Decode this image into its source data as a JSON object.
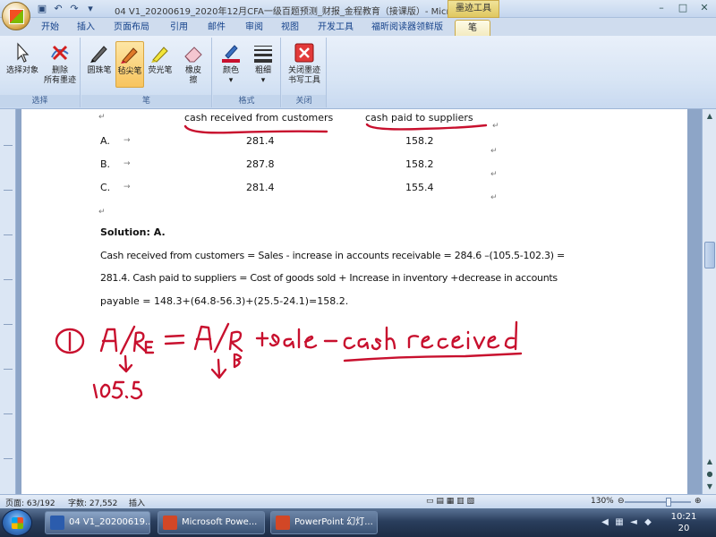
{
  "titlebar": {
    "title": "04 V1_20200619_2020年12月CFA一级百题预测_财报_金程教育（接课版）- Micros...",
    "context_tab": "墨迹工具"
  },
  "tabs": [
    "开始",
    "插入",
    "页面布局",
    "引用",
    "邮件",
    "审阅",
    "视图",
    "开发工具",
    "福昕阅读器领鲜版",
    "笔"
  ],
  "ribbon": {
    "select": {
      "label": "选择对象",
      "group": "选择"
    },
    "erase_all": {
      "label1": "删除",
      "label2": "所有墨迹"
    },
    "ballpoint": {
      "label": "圆珠笔"
    },
    "felt_pen": {
      "label": "毡尖笔"
    },
    "highlighter": {
      "label": "荧光笔"
    },
    "eraser": {
      "label1": "橡皮",
      "label2": "擦"
    },
    "pen_group": "笔",
    "color": {
      "label": "颜色"
    },
    "weight": {
      "label": "粗细"
    },
    "format_group": "格式",
    "close": {
      "label1": "关闭墨迹",
      "label2": "书写工具"
    },
    "close_group": "关闭"
  },
  "document": {
    "header_receipts": "cash received from customers",
    "header_payments": "cash paid to suppliers",
    "options": [
      {
        "letter": "A.",
        "received": "281.4",
        "paid": "158.2"
      },
      {
        "letter": "B.",
        "received": "287.8",
        "paid": "158.2"
      },
      {
        "letter": "C.",
        "received": "281.4",
        "paid": "155.4"
      }
    ],
    "solution_title": "Solution: A.",
    "solution_line1": "Cash received from customers = Sales - increase in accounts receivable = 284.6 –(105.5-102.3) =",
    "solution_line2": "281.4. Cash paid to suppliers = Cost of goods sold + Increase in inventory +decrease in accounts",
    "solution_line3": "payable = 148.3+(64.8-56.3)+(25.5-24.1)=158.2.",
    "marks": {
      "return": "↵",
      "tab": "→"
    }
  },
  "status": {
    "page": "页面: 63/192",
    "words": "字数: 27,552",
    "mode": "插入",
    "zoom": "130%",
    "zoom_percent": 130
  },
  "taskbar": {
    "tasks": [
      "04 V1_20200619...",
      "Microsoft Powe...",
      "PowerPoint 幻灯..."
    ],
    "clock_time": "10:21",
    "clock_day": "20"
  },
  "colors": {
    "ink": "#c8102e",
    "accent": "#f8c45e",
    "ribbon": "#d8e5f5"
  }
}
